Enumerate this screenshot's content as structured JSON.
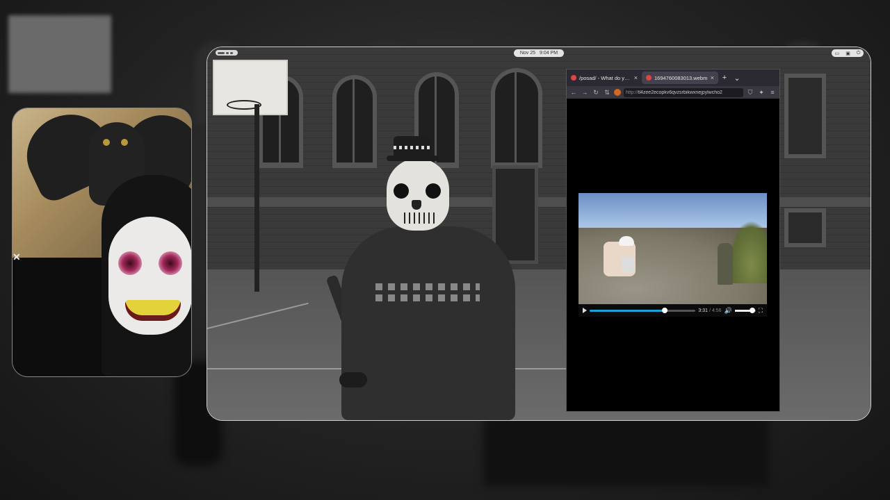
{
  "topbar": {
    "date": "Nov 25",
    "time": "9:04 PM"
  },
  "browser": {
    "tabs": [
      {
        "label": "/posad/ - What do you think",
        "active": false
      },
      {
        "label": "1694760083013.webm",
        "active": true
      }
    ],
    "new_tab": "+",
    "tab_list": "⌄",
    "url": "tl4zee2ecopkv6qvzsrbikwxnejpylwcho2",
    "url_protocol": "http://",
    "close_glyph": "×"
  },
  "video": {
    "current_time": "3:31",
    "separator": " / ",
    "duration": "4:56",
    "progress_fraction": 0.71,
    "volume_fraction": 0.85
  },
  "colors": {
    "accent": "#19a3d6",
    "tab_bg": "#2b2a33",
    "url_bg": "#1c1b22"
  },
  "icons": {
    "back": "back-arrow-icon",
    "forward": "forward-arrow-icon",
    "reload": "reload-icon",
    "shield": "shield-icon",
    "menu": "hamburger-menu-icon",
    "play": "play-icon",
    "volume": "volume-icon",
    "fullscreen": "fullscreen-icon"
  }
}
